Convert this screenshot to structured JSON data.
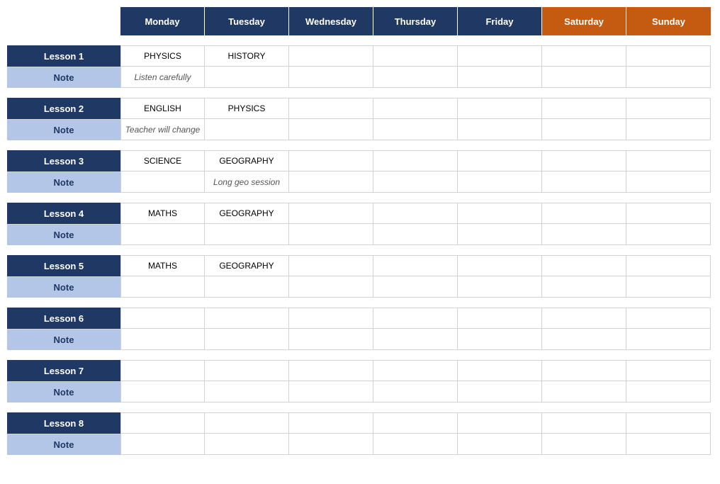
{
  "header": {
    "days": [
      "Monday",
      "Tuesday",
      "Wednesday",
      "Thursday",
      "Friday",
      "Saturday",
      "Sunday"
    ]
  },
  "rows": [
    {
      "lesson_label": "Lesson 1",
      "note_label": "Note",
      "lesson": [
        "PHYSICS",
        "HISTORY",
        "",
        "",
        "",
        "",
        ""
      ],
      "note": [
        "Listen carefully",
        "",
        "",
        "",
        "",
        "",
        ""
      ]
    },
    {
      "lesson_label": "Lesson 2",
      "note_label": "Note",
      "lesson": [
        "ENGLISH",
        "PHYSICS",
        "",
        "",
        "",
        "",
        ""
      ],
      "note": [
        "Teacher will change",
        "",
        "",
        "",
        "",
        "",
        ""
      ]
    },
    {
      "lesson_label": "Lesson 3",
      "note_label": "Note",
      "lesson": [
        "SCIENCE",
        "GEOGRAPHY",
        "",
        "",
        "",
        "",
        ""
      ],
      "note": [
        "",
        "Long geo session",
        "",
        "",
        "",
        "",
        ""
      ]
    },
    {
      "lesson_label": "Lesson 4",
      "note_label": "Note",
      "lesson": [
        "MATHS",
        "GEOGRAPHY",
        "",
        "",
        "",
        "",
        ""
      ],
      "note": [
        "",
        "",
        "",
        "",
        "",
        "",
        ""
      ]
    },
    {
      "lesson_label": "Lesson 5",
      "note_label": "Note",
      "lesson": [
        "MATHS",
        "GEOGRAPHY",
        "",
        "",
        "",
        "",
        ""
      ],
      "note": [
        "",
        "",
        "",
        "",
        "",
        "",
        ""
      ]
    },
    {
      "lesson_label": "Lesson 6",
      "note_label": "Note",
      "lesson": [
        "",
        "",
        "",
        "",
        "",
        "",
        ""
      ],
      "note": [
        "",
        "",
        "",
        "",
        "",
        "",
        ""
      ]
    },
    {
      "lesson_label": "Lesson 7",
      "note_label": "Note",
      "lesson": [
        "",
        "",
        "",
        "",
        "",
        "",
        ""
      ],
      "note": [
        "",
        "",
        "",
        "",
        "",
        "",
        ""
      ]
    },
    {
      "lesson_label": "Lesson 8",
      "note_label": "Note",
      "lesson": [
        "",
        "",
        "",
        "",
        "",
        "",
        ""
      ],
      "note": [
        "",
        "",
        "",
        "",
        "",
        "",
        ""
      ]
    }
  ]
}
